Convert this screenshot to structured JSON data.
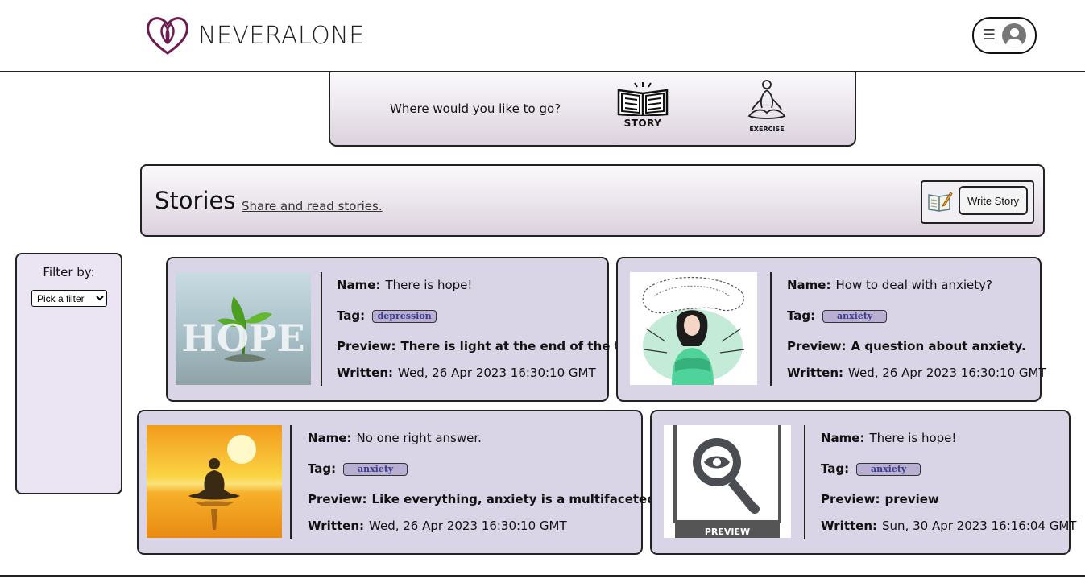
{
  "header": {
    "brand": "NEVERALONE",
    "menu_icon": "hamburger-menu-icon",
    "avatar_icon": "user-avatar-icon",
    "accent_color": "#6d1b4f"
  },
  "nav": {
    "question": "Where would you like to go?",
    "story_label": "STORY",
    "exercise_label": "EXERCISE"
  },
  "stories_banner": {
    "title": "Stories",
    "subtitle": "Share and read stories.",
    "write_button": "Write Story"
  },
  "filter": {
    "label": "Filter by:",
    "selected": "Pick a filter"
  },
  "labels": {
    "name": "Name:",
    "tag": "Tag:",
    "preview": "Preview:",
    "written": "Written:"
  },
  "stories": [
    {
      "name": "There is hope!",
      "tag": "depression",
      "preview": "There is light at the end of the tunnel.",
      "written": "Wed, 26 Apr 2023 16:30:10 GMT"
    },
    {
      "name": "How to deal with anxiety?",
      "tag": "anxiety",
      "preview": "A question about anxiety.",
      "written": "Wed, 26 Apr 2023 16:30:10 GMT"
    },
    {
      "name": "No one right answer.",
      "tag": "anxiety",
      "preview": "Like everything, anxiety is a multifaceted disease.",
      "written": "Wed, 26 Apr 2023 16:30:10 GMT"
    },
    {
      "name": "There is hope!",
      "tag": "anxiety",
      "preview": "preview",
      "written": "Sun, 30 Apr 2023 16:16:04 GMT"
    }
  ],
  "image_text": {
    "hope": "HOPE",
    "preview_caption": "PREVIEW"
  }
}
